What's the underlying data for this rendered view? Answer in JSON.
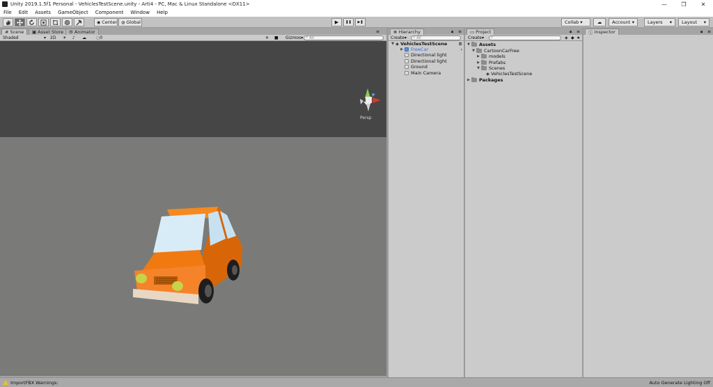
{
  "window": {
    "title": "Unity 2019.1.5f1 Personal - VehiclesTestScene.unity - Arti4 - PC, Mac & Linux Standalone <DX11>",
    "minimize": "—",
    "maximize": "❐",
    "close": "✕"
  },
  "menu": [
    "File",
    "Edit",
    "Assets",
    "GameObject",
    "Component",
    "Window",
    "Help"
  ],
  "toolbar": {
    "tools": [
      "hand-icon",
      "move-icon",
      "rotate-icon",
      "scale-icon",
      "rect-icon",
      "transform-icon",
      "custom-tool-icon"
    ],
    "pivot_label": "Center",
    "space_label": "Global",
    "play": "▶",
    "pause": "❚❚",
    "step": "▶❚",
    "collab_label": "Collab ▾",
    "account_label": "Account",
    "layers_label": "Layers",
    "layout_label": "Layout"
  },
  "scene_panel": {
    "tabs": [
      "Scene",
      "Asset Store",
      "Animator"
    ],
    "shading": "Shaded",
    "mode_2d": "2D",
    "light_toggle": "☀",
    "audio_toggle": "♪",
    "effects_toggle": "☁",
    "hidden_count": "0",
    "tools_icon": "✕",
    "camera_icon": "■",
    "gizmos_label": "Gizmos",
    "search_placeholder": "All",
    "view_mode": "Persp"
  },
  "hierarchy": {
    "tab": "Hierarchy",
    "create_label": "Create",
    "search_placeholder": "All",
    "scene_name": "VehiclesTestScene",
    "items": [
      "FreeCar",
      "Directional light",
      "Directional light",
      "Ground",
      "Main Camera"
    ]
  },
  "project": {
    "tab": "Project",
    "create_label": "Create",
    "tree": {
      "assets": "Assets",
      "cartoon": "CartoonCarFree",
      "models": "models",
      "prefabs": "Prefabs",
      "scenes": "Scenes",
      "scene_file": "VehiclesTestScene",
      "packages": "Packages"
    }
  },
  "inspector": {
    "tab": "Inspector"
  },
  "status": {
    "warning": "ImportFBX Warnings:",
    "lighting": "Auto Generate Lighting Off"
  },
  "colors": {
    "car_body": "#f07a10",
    "sky": "#464646",
    "ground": "#7a7b78",
    "selected": "#3a6fd6"
  }
}
